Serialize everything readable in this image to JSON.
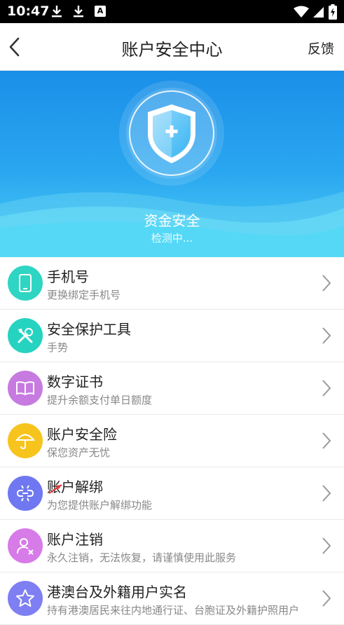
{
  "status": {
    "time": "10:47",
    "a_icon": "A"
  },
  "header": {
    "title": "账户安全中心",
    "feedback": "反馈"
  },
  "hero": {
    "title": "资金安全",
    "subtitle": "检测中..."
  },
  "items": [
    {
      "name": "手机号",
      "desc": "更换绑定手机号",
      "color": "#2fd5c3",
      "icon": "phone-icon"
    },
    {
      "name": "安全保护工具",
      "desc": "手势",
      "color": "#26d3c0",
      "icon": "tools-icon"
    },
    {
      "name": "数字证书",
      "desc": "提升余额支付单日额度",
      "color": "#c77ae0",
      "icon": "book-icon"
    },
    {
      "name": "账户安全险",
      "desc": "保您资产无忧",
      "color": "#f7c41d",
      "icon": "umbrella-icon"
    },
    {
      "name": "账户解绑",
      "desc": "为您提供账户解绑功能",
      "color": "#6f78f0",
      "icon": "unlink-icon"
    },
    {
      "name": "账户注销",
      "desc": "永久注销，无法恢复，请谨慎使用此服务",
      "color": "#d77be8",
      "icon": "user-remove-icon"
    },
    {
      "name": "港澳台及外籍用户实名",
      "desc": "持有港澳居民来往内地通行证、台胞证及外籍护照用户",
      "color": "#7e7ff2",
      "icon": "star-icon"
    }
  ]
}
